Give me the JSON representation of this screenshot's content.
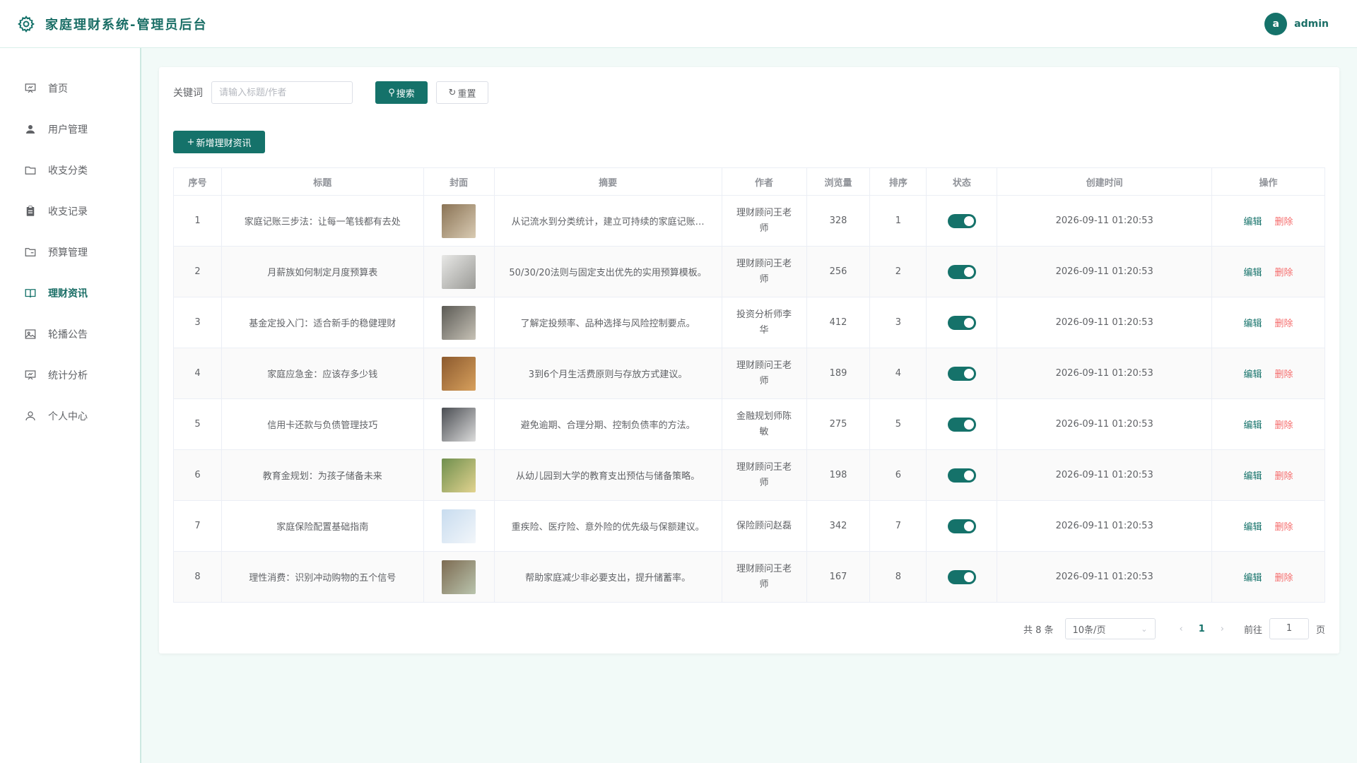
{
  "app": {
    "title": "家庭理财系统-管理员后台"
  },
  "user": {
    "avatar_letter": "a",
    "name": "admin"
  },
  "sidebar": {
    "items": [
      {
        "label": "首页",
        "icon": "presentation-icon"
      },
      {
        "label": "用户管理",
        "icon": "user-icon"
      },
      {
        "label": "收支分类",
        "icon": "folder-icon"
      },
      {
        "label": "收支记录",
        "icon": "clipboard-icon"
      },
      {
        "label": "预算管理",
        "icon": "folder-open-icon"
      },
      {
        "label": "理财资讯",
        "icon": "book-icon",
        "active": true
      },
      {
        "label": "轮播公告",
        "icon": "picture-icon"
      },
      {
        "label": "统计分析",
        "icon": "chart-board-icon"
      },
      {
        "label": "个人中心",
        "icon": "person-outline-icon"
      }
    ]
  },
  "filter": {
    "keyword_label": "关键词",
    "keyword_placeholder": "请输入标题/作者",
    "keyword_value": "",
    "search_label": "搜索",
    "reset_label": "重置"
  },
  "toolbar": {
    "add_label": "新增理财资讯"
  },
  "table": {
    "columns": [
      "序号",
      "标题",
      "封面",
      "摘要",
      "作者",
      "浏览量",
      "排序",
      "状态",
      "创建时间",
      "操作"
    ],
    "edit_label": "编辑",
    "delete_label": "删除",
    "rows": [
      {
        "no": "1",
        "title": "家庭记账三步法：让每一笔钱都有去处",
        "summary": "从记流水到分类统计，建立可持续的家庭记账…",
        "author": "理财顾问王老师",
        "views": "328",
        "sort": "1",
        "status": true,
        "created": "2026-09-11 01:20:53",
        "cover": [
          "#8a7355",
          "#d9cbb3"
        ]
      },
      {
        "no": "2",
        "title": "月薪族如何制定月度预算表",
        "summary": "50/30/20法则与固定支出优先的实用预算模板。",
        "author": "理财顾问王老师",
        "views": "256",
        "sort": "2",
        "status": true,
        "created": "2026-09-11 01:20:53",
        "cover": [
          "#e8e8e6",
          "#9a9a96"
        ]
      },
      {
        "no": "3",
        "title": "基金定投入门：适合新手的稳健理财",
        "summary": "了解定投频率、品种选择与风险控制要点。",
        "author": "投资分析师李华",
        "views": "412",
        "sort": "3",
        "status": true,
        "created": "2026-09-11 01:20:53",
        "cover": [
          "#5b5a55",
          "#c7c2b6"
        ]
      },
      {
        "no": "4",
        "title": "家庭应急金：应该存多少钱",
        "summary": "3到6个月生活费原则与存放方式建议。",
        "author": "理财顾问王老师",
        "views": "189",
        "sort": "4",
        "status": true,
        "created": "2026-09-11 01:20:53",
        "cover": [
          "#8c5a2e",
          "#d7a05d"
        ]
      },
      {
        "no": "5",
        "title": "信用卡还款与负债管理技巧",
        "summary": "避免逾期、合理分期、控制负债率的方法。",
        "author": "金融规划师陈敏",
        "views": "275",
        "sort": "5",
        "status": true,
        "created": "2026-09-11 01:20:53",
        "cover": [
          "#4a4d52",
          "#dcdcdc"
        ]
      },
      {
        "no": "6",
        "title": "教育金规划：为孩子储备未来",
        "summary": "从幼儿园到大学的教育支出预估与储备策略。",
        "author": "理财顾问王老师",
        "views": "198",
        "sort": "6",
        "status": true,
        "created": "2026-09-11 01:20:53",
        "cover": [
          "#6f8f4e",
          "#e2d38f"
        ]
      },
      {
        "no": "7",
        "title": "家庭保险配置基础指南",
        "summary": "重疾险、医疗险、意外险的优先级与保额建议。",
        "author": "保险顾问赵磊",
        "views": "342",
        "sort": "7",
        "status": true,
        "created": "2026-09-11 01:20:53",
        "cover": [
          "#c8dcef",
          "#f2f6fa"
        ]
      },
      {
        "no": "8",
        "title": "理性消费：识别冲动购物的五个信号",
        "summary": "帮助家庭减少非必要支出，提升储蓄率。",
        "author": "理财顾问王老师",
        "views": "167",
        "sort": "8",
        "status": true,
        "created": "2026-09-11 01:20:53",
        "cover": [
          "#7d6b52",
          "#b9c4ad"
        ]
      }
    ]
  },
  "pagination": {
    "total_text": "共 8 条",
    "page_size": "10条/页",
    "current_page": "1",
    "goto_label": "前往",
    "goto_value": "1",
    "page_suffix": "页"
  },
  "colors": {
    "primary": "#15726a",
    "danger": "#f56c6c",
    "background": "#f2faf8"
  }
}
